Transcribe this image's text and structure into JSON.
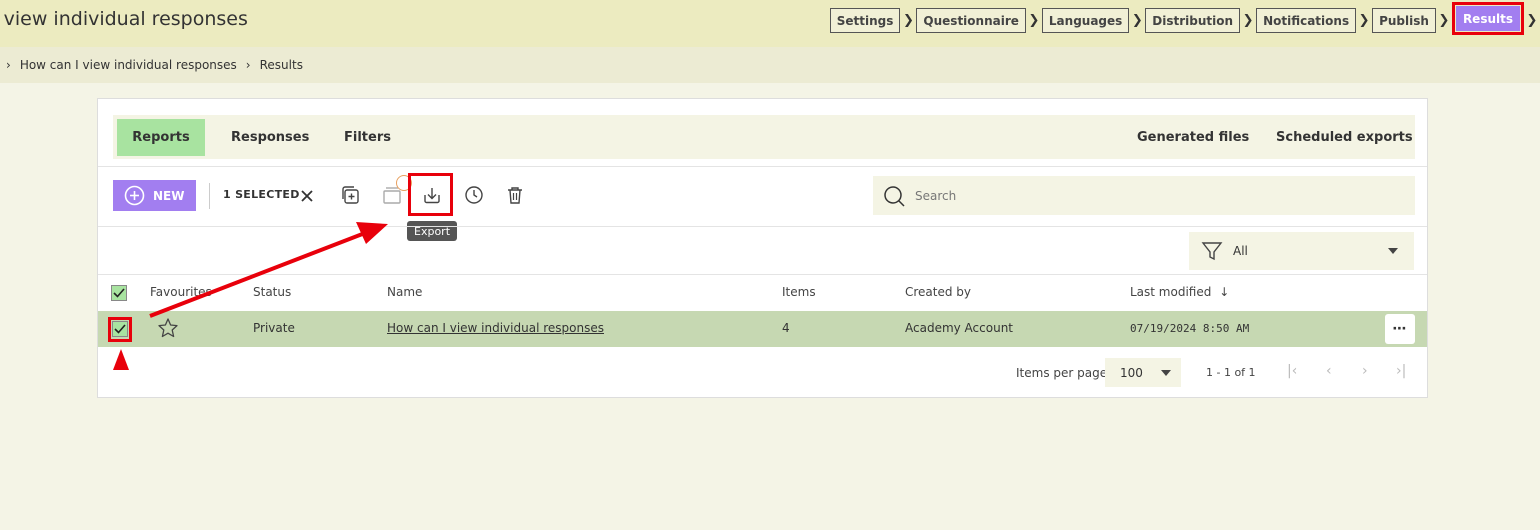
{
  "header": {
    "title": "I view individual responses",
    "steps": [
      "Settings",
      "Questionnaire",
      "Languages",
      "Distribution",
      "Notifications",
      "Publish",
      "Results"
    ],
    "active_step": "Results"
  },
  "breadcrumb": [
    "How can I view individual responses",
    "Results"
  ],
  "tabs": {
    "left": [
      "Reports",
      "Responses",
      "Filters"
    ],
    "right": [
      "Generated files",
      "Scheduled exports"
    ],
    "active": "Reports"
  },
  "toolbar": {
    "new_label": "NEW",
    "selected_label": "1 SELECTED",
    "export_tooltip": "Export",
    "search_placeholder": "Search"
  },
  "filter": {
    "value": "All"
  },
  "table": {
    "columns": [
      "Favourites",
      "Status",
      "Name",
      "Items",
      "Created by",
      "Last modified"
    ],
    "rows": [
      {
        "status": "Private",
        "name": "How can I view individual responses",
        "items": "4",
        "created_by": "Academy Account",
        "last_modified": "07/19/2024 8:50 AM"
      }
    ]
  },
  "pagination": {
    "items_per_page_label": "Items per page",
    "items_per_page": "100",
    "range": "1 - 1 of 1"
  },
  "colors": {
    "accent": "#a27ef0",
    "selected_tab": "#a8e3a0",
    "selected_row": "#c6d8b2",
    "annotation": "#e8000b"
  }
}
